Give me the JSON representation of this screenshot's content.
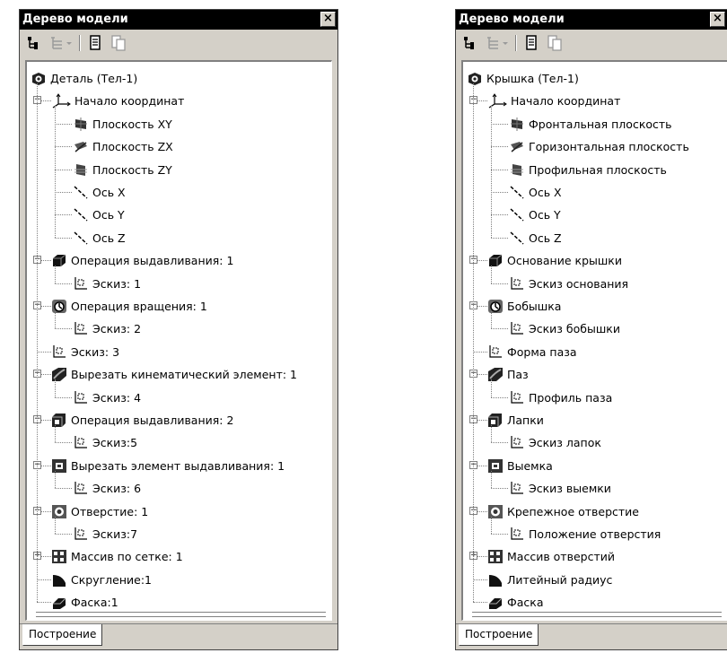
{
  "left": {
    "title": "Дерево модели",
    "tab": "Построение",
    "items": [
      {
        "label": "Деталь (Тел-1)",
        "icon": "part-icon",
        "level": 0
      },
      {
        "label": "Начало координат",
        "icon": "origin-icon",
        "level": 1,
        "expander": "−"
      },
      {
        "label": "Плоскость XY",
        "icon": "plane-xy-icon",
        "level": 2
      },
      {
        "label": "Плоскость ZX",
        "icon": "plane-zx-icon",
        "level": 2
      },
      {
        "label": "Плоскость ZY",
        "icon": "plane-zy-icon",
        "level": 2
      },
      {
        "label": "Ось X",
        "icon": "axis-icon",
        "level": 2
      },
      {
        "label": "Ось Y",
        "icon": "axis-icon",
        "level": 2
      },
      {
        "label": "Ось Z",
        "icon": "axis-icon",
        "level": 2
      },
      {
        "label": "Операция выдавливания: 1",
        "icon": "extrude-icon",
        "level": 1,
        "expander": "−"
      },
      {
        "label": "Эскиз: 1",
        "icon": "sketch-icon",
        "level": 2
      },
      {
        "label": "Операция вращения: 1",
        "icon": "revolve-icon",
        "level": 1,
        "expander": "−"
      },
      {
        "label": "Эскиз: 2",
        "icon": "sketch-icon",
        "level": 2
      },
      {
        "label": "Эскиз: 3",
        "icon": "sketch-icon",
        "level": 1
      },
      {
        "label": "Вырезать кинематический элемент: 1",
        "icon": "sweep-cut-icon",
        "level": 1,
        "expander": "−"
      },
      {
        "label": "Эскиз: 4",
        "icon": "sketch-icon",
        "level": 2
      },
      {
        "label": "Операция выдавливания: 2",
        "icon": "extrude2-icon",
        "level": 1,
        "expander": "−"
      },
      {
        "label": "Эскиз:5",
        "icon": "sketch-icon",
        "level": 2
      },
      {
        "label": "Вырезать элемент выдавливания: 1",
        "icon": "cut-extrude-icon",
        "level": 1,
        "expander": "−"
      },
      {
        "label": "Эскиз: 6",
        "icon": "sketch-icon",
        "level": 2
      },
      {
        "label": "Отверстие: 1",
        "icon": "hole-icon",
        "level": 1,
        "expander": "−"
      },
      {
        "label": "Эскиз:7",
        "icon": "sketch-icon",
        "level": 2
      },
      {
        "label": "Массив по сетке: 1",
        "icon": "array-icon",
        "level": 1,
        "expander": "+"
      },
      {
        "label": "Скругление:1",
        "icon": "fillet-icon",
        "level": 1
      },
      {
        "label": "Фаска:1",
        "icon": "chamfer-icon",
        "level": 1
      }
    ]
  },
  "right": {
    "title": "Дерево модели",
    "tab": "Построение",
    "items": [
      {
        "label": "Крышка (Тел-1)",
        "icon": "part-icon",
        "level": 0
      },
      {
        "label": "Начало координат",
        "icon": "origin-icon",
        "level": 1,
        "expander": "−"
      },
      {
        "label": "Фронтальная плоскость",
        "icon": "plane-xy-icon",
        "level": 2
      },
      {
        "label": "Горизонтальная плоскость",
        "icon": "plane-zx-icon",
        "level": 2
      },
      {
        "label": "Профильная плоскость",
        "icon": "plane-zy-icon",
        "level": 2
      },
      {
        "label": "Ось X",
        "icon": "axis-icon",
        "level": 2
      },
      {
        "label": "Ось Y",
        "icon": "axis-icon",
        "level": 2
      },
      {
        "label": "Ось Z",
        "icon": "axis-icon",
        "level": 2
      },
      {
        "label": "Основание крышки",
        "icon": "extrude-icon",
        "level": 1,
        "expander": "−"
      },
      {
        "label": "Эскиз основания",
        "icon": "sketch-icon",
        "level": 2
      },
      {
        "label": "Бобышка",
        "icon": "revolve-icon",
        "level": 1,
        "expander": "−"
      },
      {
        "label": "Эскиз бобышки",
        "icon": "sketch-icon",
        "level": 2
      },
      {
        "label": "Форма паза",
        "icon": "sketch-icon",
        "level": 1
      },
      {
        "label": "Паз",
        "icon": "sweep-cut-icon",
        "level": 1,
        "expander": "−"
      },
      {
        "label": "Профиль паза",
        "icon": "sketch-icon",
        "level": 2
      },
      {
        "label": "Лапки",
        "icon": "extrude2-icon",
        "level": 1,
        "expander": "−"
      },
      {
        "label": "Эскиз лапок",
        "icon": "sketch-icon",
        "level": 2
      },
      {
        "label": "Выемка",
        "icon": "cut-extrude-icon",
        "level": 1,
        "expander": "−"
      },
      {
        "label": "Эскиз выемки",
        "icon": "sketch-icon",
        "level": 2
      },
      {
        "label": "Крепежное отверстие",
        "icon": "hole-icon",
        "level": 1,
        "expander": "−"
      },
      {
        "label": "Положение отверстия",
        "icon": "sketch-icon",
        "level": 2
      },
      {
        "label": "Массив отверстий",
        "icon": "array-icon",
        "level": 1,
        "expander": "+"
      },
      {
        "label": "Литейный радиус",
        "icon": "fillet-icon",
        "level": 1
      },
      {
        "label": "Фаска",
        "icon": "chamfer-icon",
        "level": 1
      }
    ]
  },
  "toolbar_icons": [
    "tree-structure-icon",
    "tree-list-icon",
    "dropdown-arrow-icon",
    "properties-icon",
    "copy-properties-icon"
  ],
  "close_glyph": "×"
}
